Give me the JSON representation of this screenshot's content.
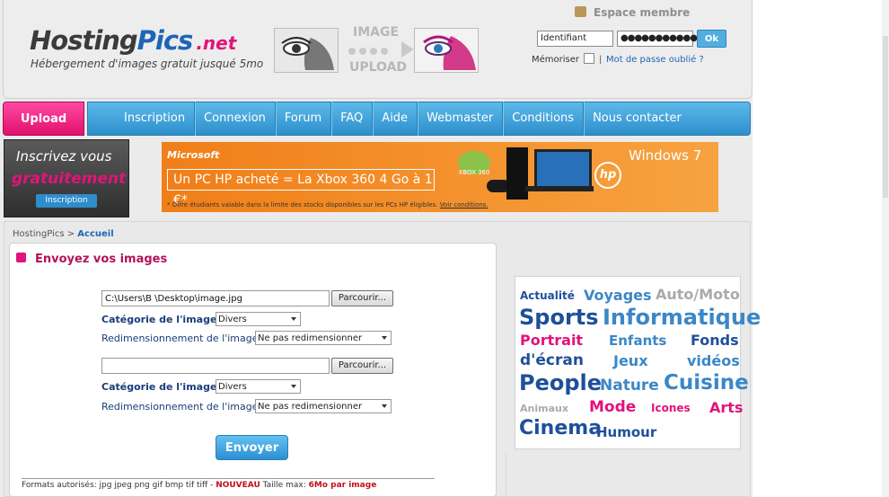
{
  "header": {
    "logo": {
      "part1": "Hosting",
      "part2": "Pics",
      "part3": ".net"
    },
    "tagline": "Hébergement d'images gratuit jusqué 5mo",
    "image_upload_label": {
      "top": "IMAGE",
      "bottom": "UPLOAD"
    }
  },
  "member": {
    "title": "Espace membre",
    "username_value": "Identifiant",
    "password_value": "●●●●●●●●●●●●",
    "ok_label": "Ok",
    "remember_label": "Mémoriser",
    "separator": "|",
    "forgot_label": "Mot de passe oublié ?"
  },
  "nav": {
    "upload_label": "Upload",
    "items": [
      "Inscription",
      "Connexion",
      "Forum",
      "FAQ",
      "Aide",
      "Webmaster",
      "Conditions",
      "Nous contacter"
    ]
  },
  "signup_box": {
    "line1": "Inscrivez vous",
    "line2": "gratuitement",
    "button": "Inscription"
  },
  "banner": {
    "brand": "Microsoft",
    "offer": "Un PC HP acheté = La Xbox 360 4 Go à 1 €*",
    "note": "* Offre étudiants valable dans la limite des stocks disponibles sur les PCs HP éligibles.",
    "note_link": "Voir conditions.",
    "windows": "Windows 7",
    "hp": "hp",
    "xbox": "XBOX 360"
  },
  "breadcrumb": {
    "root": "HostingPics",
    "sep": ">",
    "current": "Accueil"
  },
  "upload_form": {
    "title": "Envoyez vos images",
    "rows": [
      {
        "file_value": "C:\\Users\\B                       \\Desktop\\image.jpg",
        "browse_label": "Parcourir...",
        "category_label": "Catégorie de l'image :",
        "category_value": "Divers",
        "resize_label": "Redimensionnement de l'image",
        "resize_value": "Ne pas redimensionner"
      },
      {
        "file_value": "",
        "browse_label": "Parcourir...",
        "category_label": "Catégorie de l'image :",
        "category_value": "Divers",
        "resize_label": "Redimensionnement de l'image",
        "resize_value": "Ne pas redimensionner"
      }
    ],
    "submit_label": "Envoyer",
    "formats_text": "Formats autorisés: jpg jpeg png gif bmp tif tiff - ",
    "nouveau": "NOUVEAU",
    "size_text": " Taille max: ",
    "size_value": "6Mo par image"
  },
  "tag_cloud": [
    {
      "text": "Actualité",
      "color": "#1e4f9a"
    },
    {
      "text": "Voyages",
      "color": "#3b87c7"
    },
    {
      "text": "Auto/Moto",
      "color": "#aaaaaa"
    },
    {
      "text": "Sports",
      "color": "#1e4f9a"
    },
    {
      "text": "Informatique",
      "color": "#3b87c7"
    },
    {
      "text": "Portrait",
      "color": "#e2137a"
    },
    {
      "text": "Enfants",
      "color": "#3b87c7"
    },
    {
      "text": "Fonds",
      "color": "#1e4f9a"
    },
    {
      "text": "d'écran",
      "color": "#1e4f9a"
    },
    {
      "text": "Jeux",
      "color": "#3b87c7"
    },
    {
      "text": "vidéos",
      "color": "#3b87c7"
    },
    {
      "text": "People",
      "color": "#1e4f9a"
    },
    {
      "text": "Nature",
      "color": "#3b87c7"
    },
    {
      "text": "Cuisine",
      "color": "#3b87c7"
    },
    {
      "text": "Animaux",
      "color": "#aaaaaa"
    },
    {
      "text": "Mode",
      "color": "#e2137a"
    },
    {
      "text": "Icones",
      "color": "#e2137a"
    },
    {
      "text": "Arts",
      "color": "#e2137a"
    },
    {
      "text": "Cinema",
      "color": "#1e4f9a"
    },
    {
      "text": "Humour",
      "color": "#1e4f9a"
    }
  ]
}
